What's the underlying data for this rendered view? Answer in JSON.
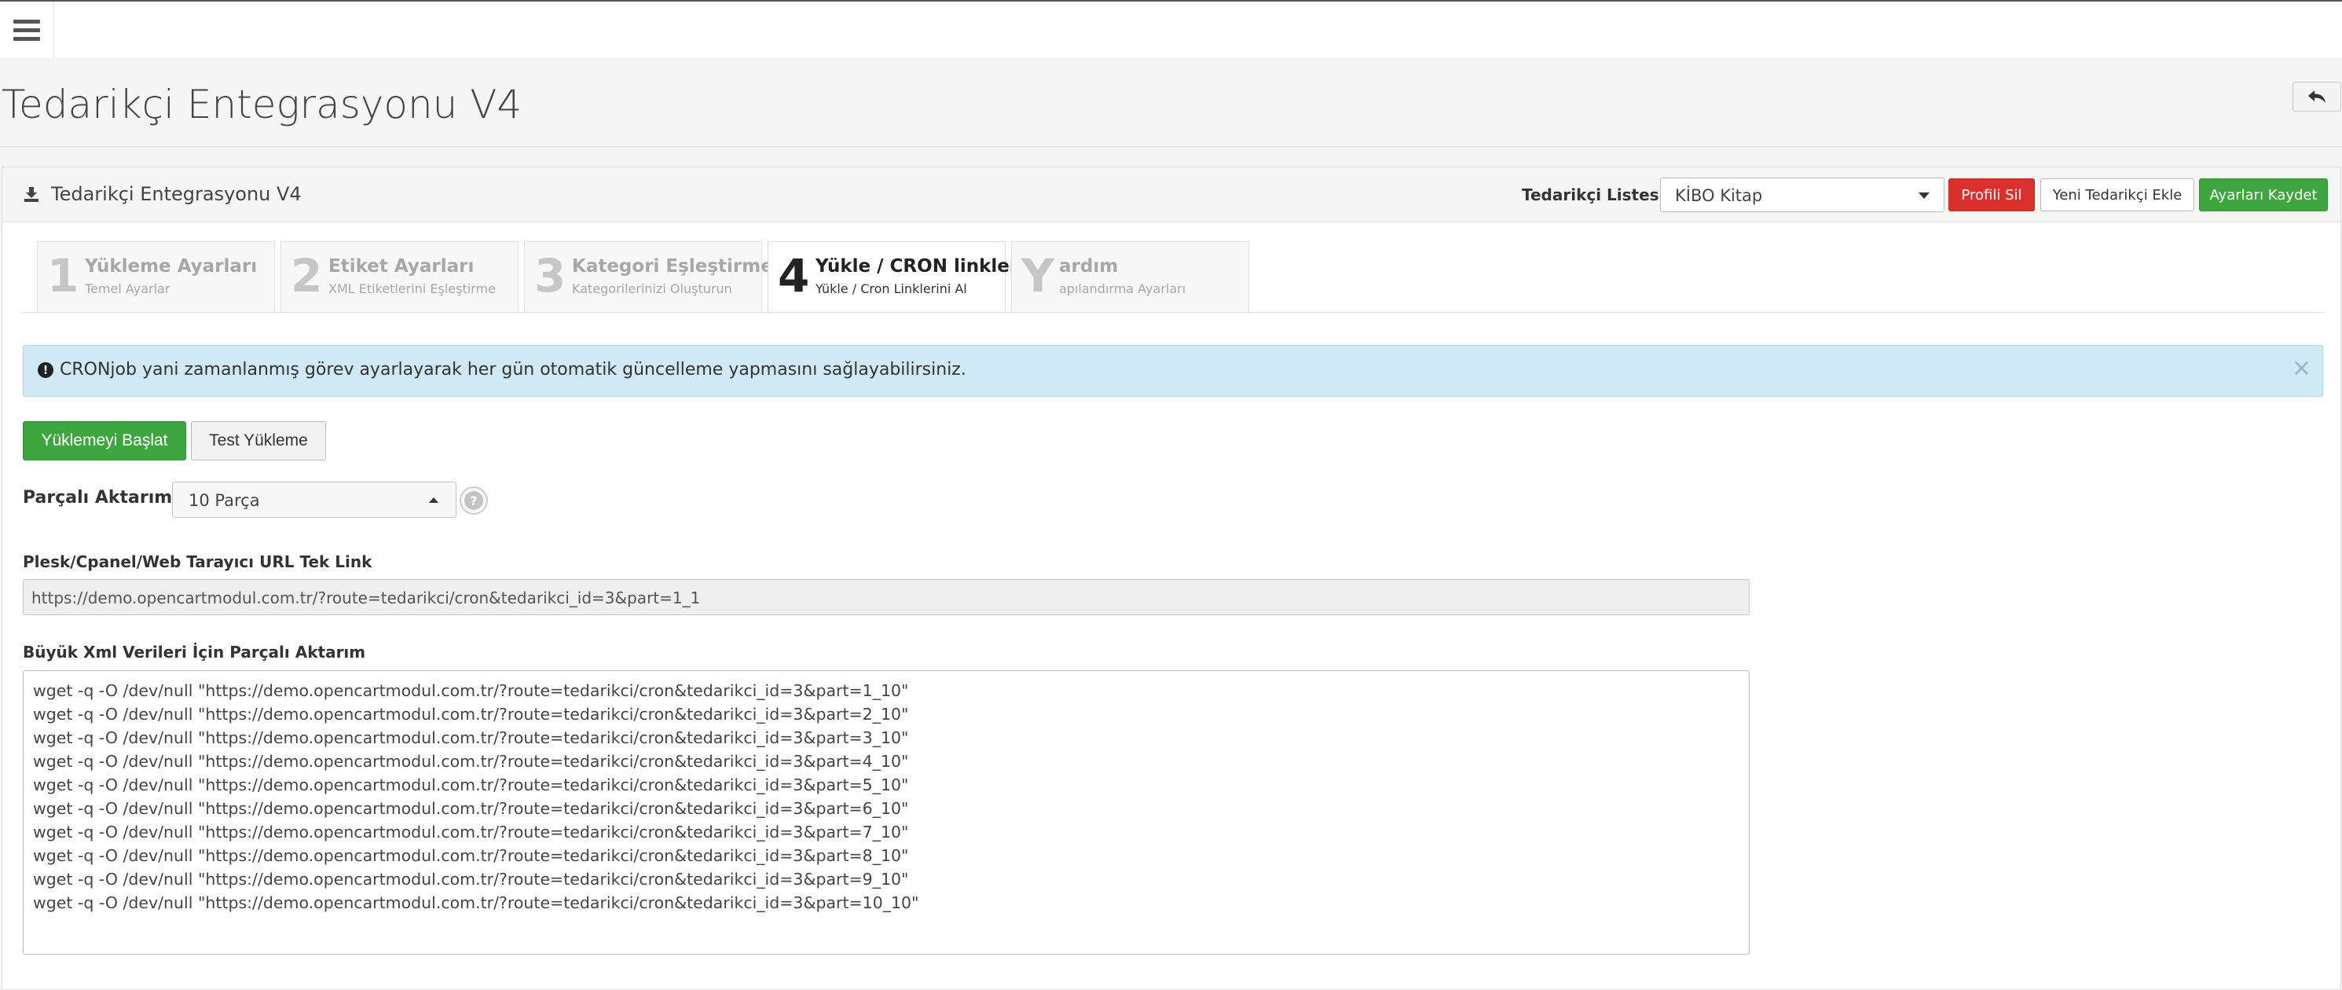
{
  "topbar": {
    "menu_icon": "hamburger-icon"
  },
  "page": {
    "title": "Tedarikçi Entegrasyonu V4",
    "back_icon": "reply-icon"
  },
  "panel": {
    "title": "Tedarikçi Entegrasyonu V4",
    "title_icon": "download-icon",
    "supplier_label": "Tedarikçi Listesi:",
    "supplier_selected": "KİBO Kitap",
    "btn_delete_profile": "Profili Sil",
    "btn_new_supplier": "Yeni Tedarikçi Ekle",
    "btn_save_settings": "Ayarları Kaydet"
  },
  "tabs": [
    {
      "num": "1",
      "title": "Yükleme Ayarları",
      "subtitle": "Temel Ayarlar",
      "active": false
    },
    {
      "num": "2",
      "title": "Etiket Ayarları",
      "subtitle": "XML Etiketlerini Eşleştirme",
      "active": false
    },
    {
      "num": "3",
      "title": "Kategori Eşleştirme",
      "subtitle": "Kategorilerinizi Oluşturun",
      "active": false
    },
    {
      "num": "4",
      "title": "Yükle / CRON linkleri",
      "subtitle": "Yükle / Cron Linklerini Al",
      "active": true
    },
    {
      "num": "Y",
      "title": "ardım",
      "subtitle": "apılandırma Ayarları",
      "active": false
    }
  ],
  "alert": {
    "icon": "info-circle-icon",
    "text": "CRONjob yani zamanlanmış görev ayarlayarak her gün otomatik güncelleme yapmasını sağlayabilirsiniz.",
    "close": "×"
  },
  "actions": {
    "start": "Yüklemeyi Başlat",
    "test": "Test Yükleme"
  },
  "partial": {
    "label": "Parçalı Aktarım:",
    "selected": "10 Parça",
    "help_icon": "question-circle-icon",
    "help_glyph": "?"
  },
  "single_link": {
    "label": "Plesk/Cpanel/Web Tarayıcı URL Tek Link",
    "value": "https://demo.opencartmodul.com.tr/?route=tedarikci/cron&tedarikci_id=3&part=1_1"
  },
  "bulk": {
    "label": "Büyük Xml Verileri İçin Parçalı Aktarım",
    "lines": [
      "wget -q -O /dev/null \"https://demo.opencartmodul.com.tr/?route=tedarikci/cron&tedarikci_id=3&part=1_10\"",
      "wget -q -O /dev/null \"https://demo.opencartmodul.com.tr/?route=tedarikci/cron&tedarikci_id=3&part=2_10\"",
      "wget -q -O /dev/null \"https://demo.opencartmodul.com.tr/?route=tedarikci/cron&tedarikci_id=3&part=3_10\"",
      "wget -q -O /dev/null \"https://demo.opencartmodul.com.tr/?route=tedarikci/cron&tedarikci_id=3&part=4_10\"",
      "wget -q -O /dev/null \"https://demo.opencartmodul.com.tr/?route=tedarikci/cron&tedarikci_id=3&part=5_10\"",
      "wget -q -O /dev/null \"https://demo.opencartmodul.com.tr/?route=tedarikci/cron&tedarikci_id=3&part=6_10\"",
      "wget -q -O /dev/null \"https://demo.opencartmodul.com.tr/?route=tedarikci/cron&tedarikci_id=3&part=7_10\"",
      "wget -q -O /dev/null \"https://demo.opencartmodul.com.tr/?route=tedarikci/cron&tedarikci_id=3&part=8_10\"",
      "wget -q -O /dev/null \"https://demo.opencartmodul.com.tr/?route=tedarikci/cron&tedarikci_id=3&part=9_10\"",
      "wget -q -O /dev/null \"https://demo.opencartmodul.com.tr/?route=tedarikci/cron&tedarikci_id=3&part=10_10\""
    ]
  },
  "colors": {
    "danger": "#d9302c",
    "success": "#3fa63f",
    "info_bg": "#cfe9f5"
  }
}
